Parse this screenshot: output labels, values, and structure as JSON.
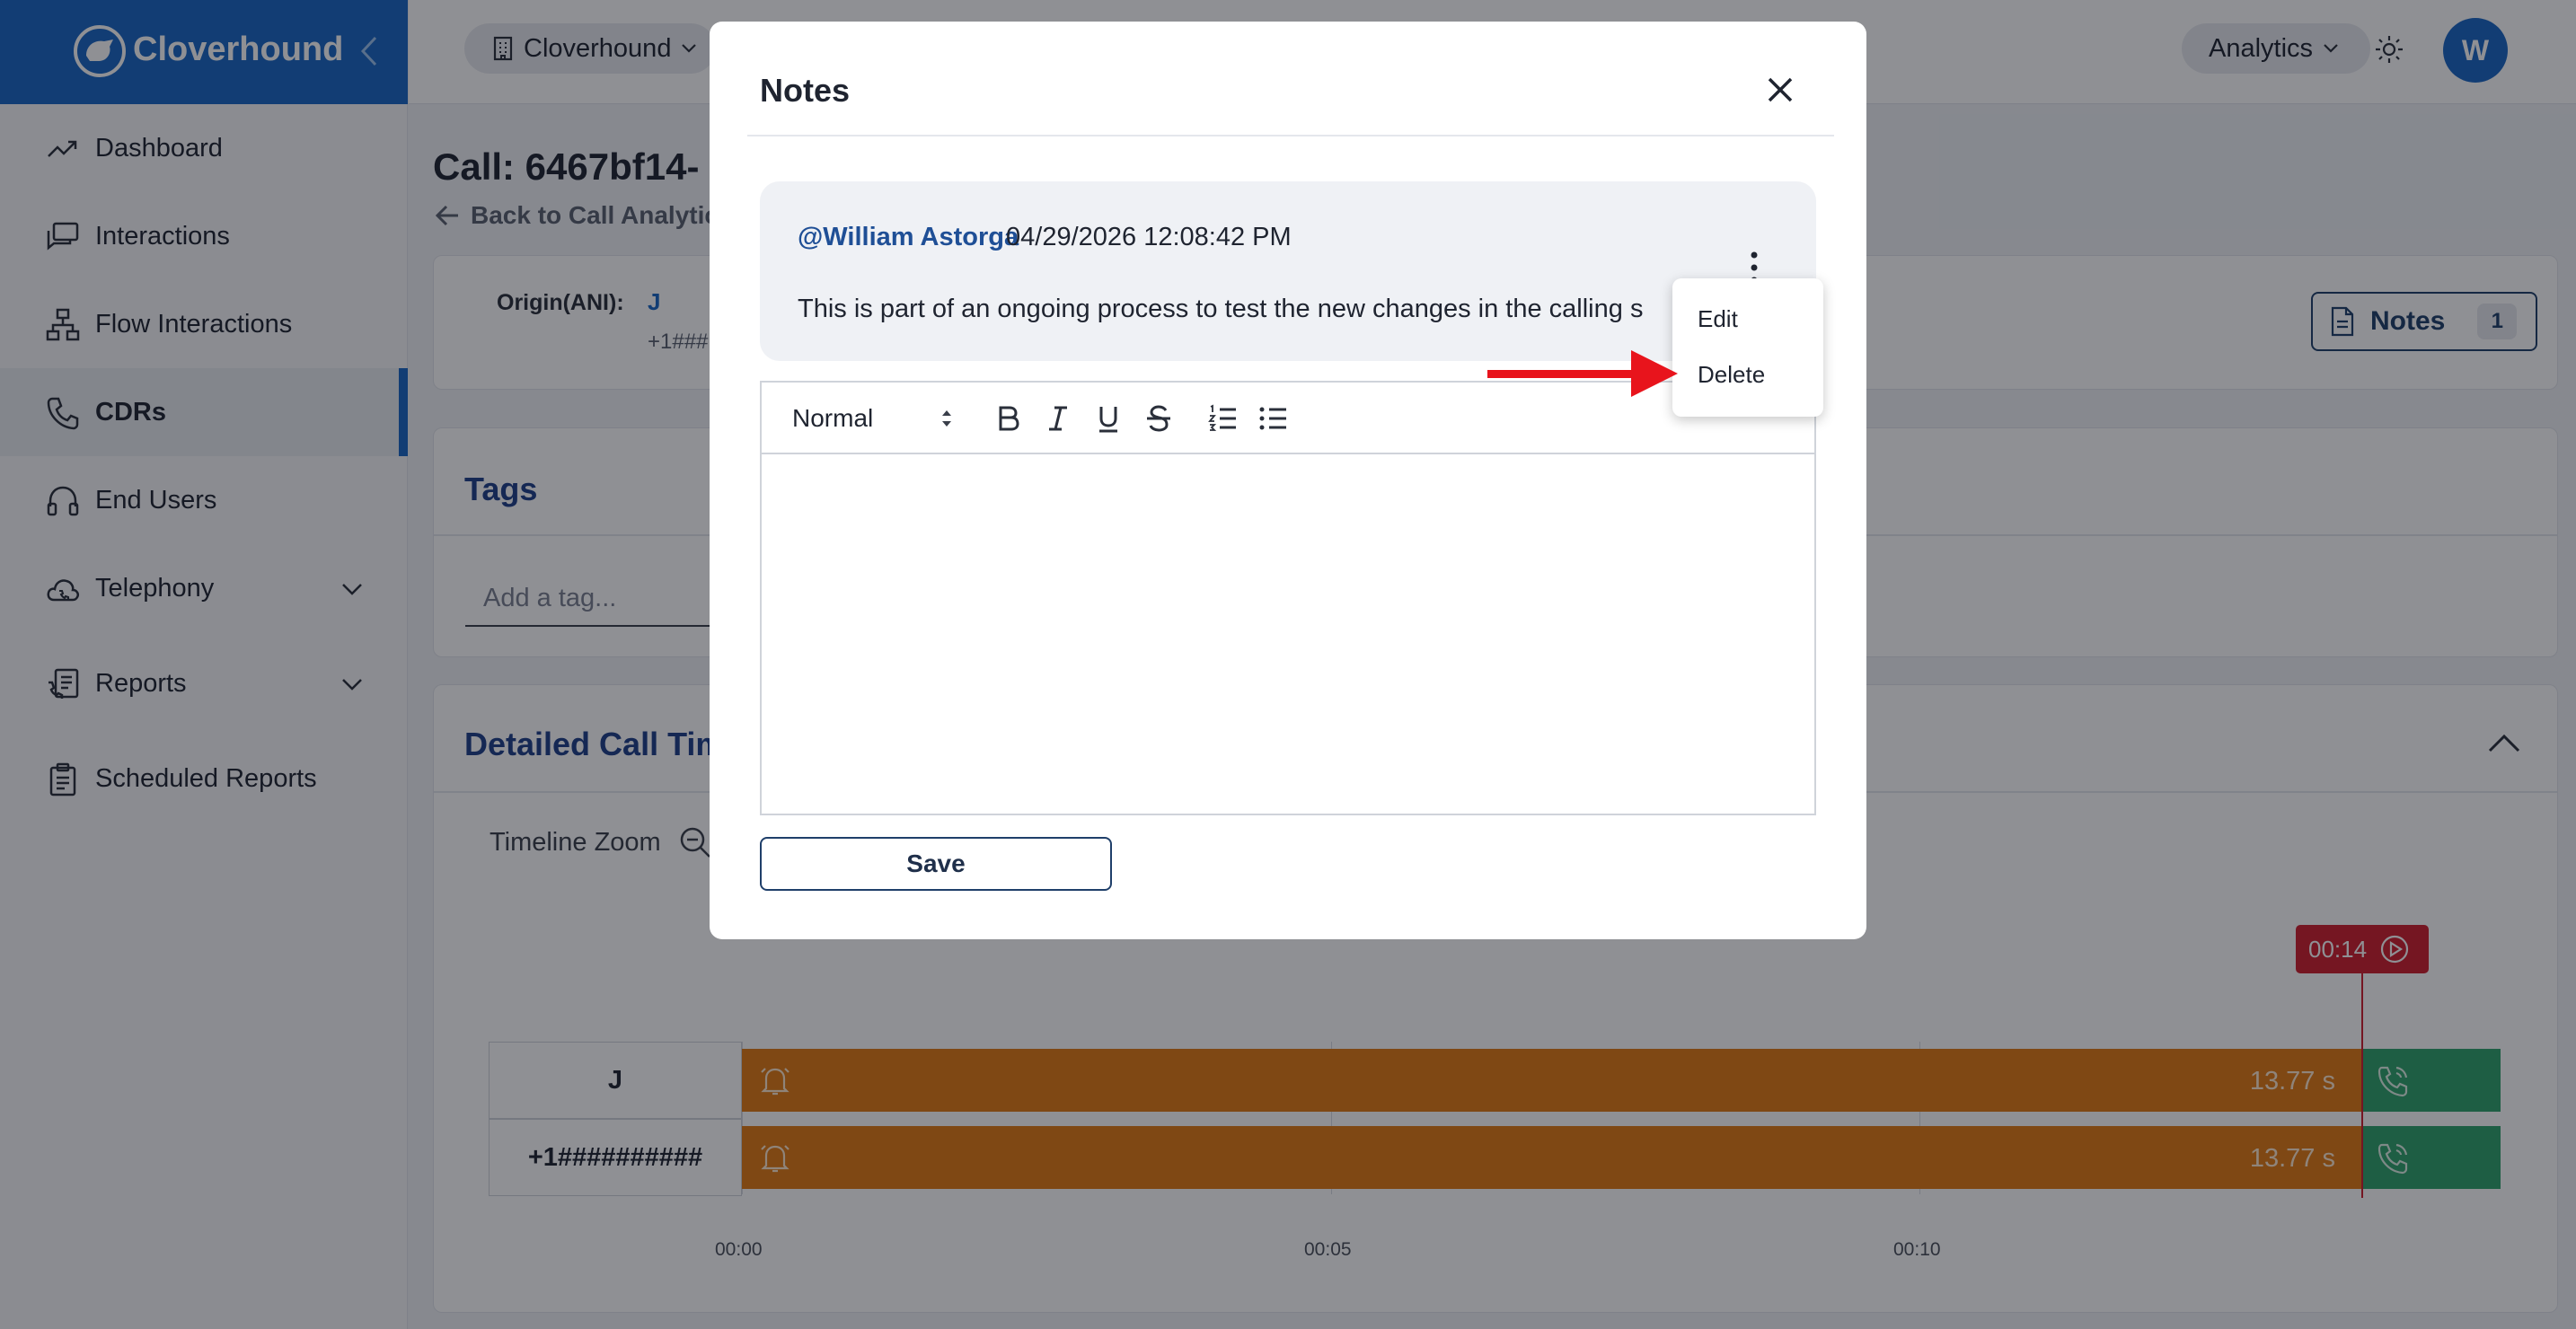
{
  "brand": {
    "name": "Cloverhound"
  },
  "sidebar": {
    "items": [
      {
        "label": "Dashboard",
        "icon": "trending-up-icon"
      },
      {
        "label": "Interactions",
        "icon": "chat-bubbles-icon"
      },
      {
        "label": "Flow Interactions",
        "icon": "flow-chart-icon"
      },
      {
        "label": "CDRs",
        "icon": "phone-icon"
      },
      {
        "label": "End Users",
        "icon": "headset-icon"
      },
      {
        "label": "Telephony",
        "icon": "cloud-phone-icon"
      },
      {
        "label": "Reports",
        "icon": "report-phone-icon"
      },
      {
        "label": "Scheduled Reports",
        "icon": "clipboard-icon"
      }
    ]
  },
  "header": {
    "org": "Cloverhound",
    "analytics": "Analytics",
    "avatar_initial": "W"
  },
  "page": {
    "title": "Call: 6467bf14-",
    "back_link": "Back to Call Analytic",
    "origin_label": "Origin(ANI):",
    "origin_value": "J",
    "origin_sub": "+1###",
    "notes_label": "Notes",
    "notes_count": "1",
    "tags_title": "Tags",
    "tag_placeholder": "Add a tag...",
    "timeline_title": "Detailed Call Tim",
    "timeline_zoom": "Timeline Zoom"
  },
  "timeline": {
    "playhead": "00:14",
    "rows": [
      {
        "label": "J",
        "duration": "13.77 s"
      },
      {
        "label": "+1##########",
        "duration": "13.77 s"
      }
    ],
    "ticks": [
      "00:00",
      "00:05",
      "00:10"
    ]
  },
  "modal": {
    "title": "Notes",
    "note": {
      "author": "@William Astorga",
      "timestamp": "04/29/2026 12:08:42 PM",
      "text": "This is part of an ongoing process to test the new changes in the calling s"
    },
    "editor": {
      "format": "Normal"
    },
    "save_label": "Save"
  },
  "context_menu": {
    "edit": "Edit",
    "delete": "Delete"
  },
  "colors": {
    "brand_blue": "#1866c4",
    "timeline_orange": "#e17a14",
    "timeline_green": "#2fa36b",
    "playhead_red": "#d01f2e",
    "annotation_red": "#e8141c"
  }
}
